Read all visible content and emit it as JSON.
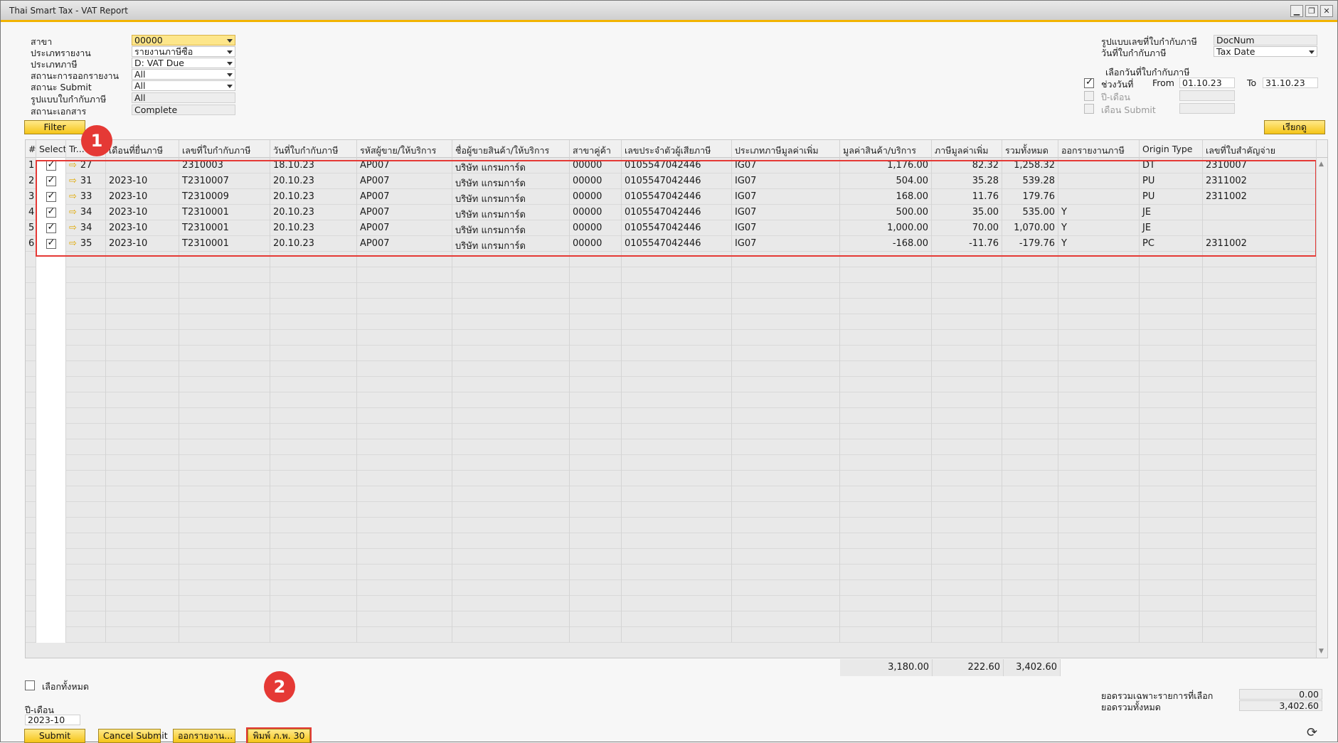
{
  "window": {
    "title": "Thai Smart Tax - VAT Report",
    "controls": [
      "▁",
      "❐",
      "✕"
    ]
  },
  "filters": {
    "branch": {
      "label": "สาขา",
      "value": "00000"
    },
    "report_type": {
      "label": "ประเภทรายงาน",
      "value": "รายงานภาษีซื้อ"
    },
    "tax_type": {
      "label": "ประเภทภาษี",
      "value": "D: VAT Due"
    },
    "report_status": {
      "label": "สถานะการออกรายงาน",
      "value": "All"
    },
    "submit_status": {
      "label": "สถานะ Submit",
      "value": "All"
    },
    "invoice_format": {
      "label": "รูปแบบใบกำกับภาษี",
      "value": "All"
    },
    "doc_status": {
      "label": "สถานะเอกสาร",
      "value": "Complete"
    },
    "filter_button": "Filter"
  },
  "right_panel": {
    "invoice_number_format": {
      "label": "รูปแบบเลขที่ใบกำกับภาษี",
      "value": "DocNum"
    },
    "invoice_date": {
      "label": "วันที่ใบกำกับภาษี",
      "value": "Tax Date"
    },
    "date_choice_title": "เลือกวันที่ใบกำกับภาษี",
    "date_range": {
      "label": "ช่วงวันที่",
      "checked": true,
      "from_label": "From",
      "from_value": "01.10.23",
      "to_label": "To",
      "to_value": "31.10.23"
    },
    "year_month": {
      "label": "ปี-เดือน",
      "checked": false
    },
    "submit_month": {
      "label": "เดือน Submit",
      "checked": false
    },
    "sort_button": "เรียกดู"
  },
  "grid": {
    "columns": [
      "#",
      "Select",
      "Tr...",
      "เดือนที่ยื่นภาษี",
      "เลขที่ใบกำกับภาษี",
      "วันที่ใบกำกับภาษี",
      "รหัสผู้ขาย/ให้บริการ",
      "ชื่อผู้ขายสินค้า/ให้บริการ",
      "สาขาคู่ค้า",
      "เลขประจำตัวผู้เสียภาษี",
      "ประเภทภาษีมูลค่าเพิ่ม",
      "มูลค่าสินค้า/บริการ",
      "ภาษีมูลค่าเพิ่ม",
      "รวมทั้งหมด",
      "ออกรายงานภาษี",
      "Origin Type",
      "เลขที่ใบสำคัญจ่าย"
    ],
    "rows": [
      {
        "no": "1",
        "selected": true,
        "trans": "27",
        "month": "",
        "invoice_no": "2310003",
        "invoice_date": "18.10.23",
        "vendor_code": "AP007",
        "vendor_name": "บริษัท แกรมการ์ด",
        "partner_branch": "00000",
        "tax_id": "0105547042446",
        "vat_type": "IG07",
        "amount": "1,176.00",
        "vat": "82.32",
        "total": "1,258.32",
        "reported": "",
        "origin_type": "DT",
        "voucher_no": "2310007"
      },
      {
        "no": "2",
        "selected": true,
        "trans": "31",
        "month": "2023-10",
        "invoice_no": "T2310007",
        "invoice_date": "20.10.23",
        "vendor_code": "AP007",
        "vendor_name": "บริษัท แกรมการ์ด",
        "partner_branch": "00000",
        "tax_id": "0105547042446",
        "vat_type": "IG07",
        "amount": "504.00",
        "vat": "35.28",
        "total": "539.28",
        "reported": "",
        "origin_type": "PU",
        "voucher_no": "2311002"
      },
      {
        "no": "3",
        "selected": true,
        "trans": "33",
        "month": "2023-10",
        "invoice_no": "T2310009",
        "invoice_date": "20.10.23",
        "vendor_code": "AP007",
        "vendor_name": "บริษัท แกรมการ์ด",
        "partner_branch": "00000",
        "tax_id": "0105547042446",
        "vat_type": "IG07",
        "amount": "168.00",
        "vat": "11.76",
        "total": "179.76",
        "reported": "",
        "origin_type": "PU",
        "voucher_no": "2311002"
      },
      {
        "no": "4",
        "selected": true,
        "trans": "34",
        "month": "2023-10",
        "invoice_no": "T2310001",
        "invoice_date": "20.10.23",
        "vendor_code": "AP007",
        "vendor_name": "บริษัท แกรมการ์ด",
        "partner_branch": "00000",
        "tax_id": "0105547042446",
        "vat_type": "IG07",
        "amount": "500.00",
        "vat": "35.00",
        "total": "535.00",
        "reported": "Y",
        "origin_type": "JE",
        "voucher_no": ""
      },
      {
        "no": "5",
        "selected": true,
        "trans": "34",
        "month": "2023-10",
        "invoice_no": "T2310001",
        "invoice_date": "20.10.23",
        "vendor_code": "AP007",
        "vendor_name": "บริษัท แกรมการ์ด",
        "partner_branch": "00000",
        "tax_id": "0105547042446",
        "vat_type": "IG07",
        "amount": "1,000.00",
        "vat": "70.00",
        "total": "1,070.00",
        "reported": "Y",
        "origin_type": "JE",
        "voucher_no": ""
      },
      {
        "no": "6",
        "selected": true,
        "trans": "35",
        "month": "2023-10",
        "invoice_no": "T2310001",
        "invoice_date": "20.10.23",
        "vendor_code": "AP007",
        "vendor_name": "บริษัท แกรมการ์ด",
        "partner_branch": "00000",
        "tax_id": "0105547042446",
        "vat_type": "IG07",
        "amount": "-168.00",
        "vat": "-11.76",
        "total": "-179.76",
        "reported": "Y",
        "origin_type": "PC",
        "voucher_no": "2311002"
      }
    ],
    "totals": {
      "amount": "3,180.00",
      "vat": "222.60",
      "total": "3,402.60"
    }
  },
  "bottom": {
    "select_all_label": "เลือกทั้งหมด",
    "year_month_label": "ปี-เดือน",
    "year_month_value": "2023-10",
    "buttons": {
      "submit": "Submit",
      "cancel_submit": "Cancel Submit",
      "report": "ออกรายงาน...",
      "print": "พิมพ์ ภ.พ. 30"
    },
    "selected_total_label": "ยอดรวมเฉพาะรายการที่เลือก",
    "selected_total_value": "0.00",
    "grand_total_label": "ยอดรวมทั้งหมด",
    "grand_total_value": "3,402.60"
  },
  "annotations": {
    "badge1": "1",
    "badge2": "2"
  },
  "colors": {
    "accent": "#f5c518",
    "highlight": "#e53935"
  }
}
